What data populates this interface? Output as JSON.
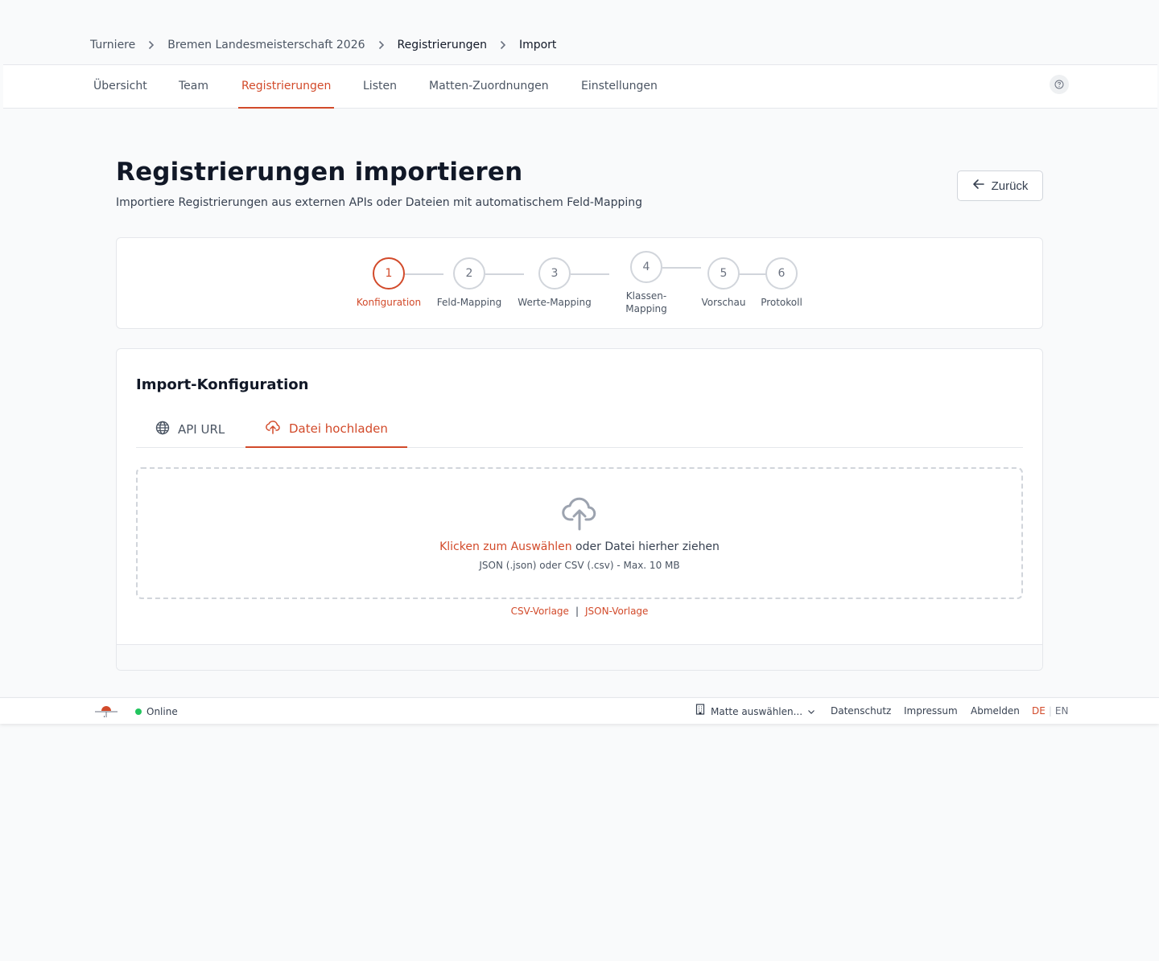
{
  "breadcrumb": {
    "items": [
      "Turniere",
      "Bremen Landesmeisterschaft 2026",
      "Registrierungen",
      "Import"
    ]
  },
  "nav": {
    "tabs": [
      "Übersicht",
      "Team",
      "Registrierungen",
      "Listen",
      "Matten-Zuordnungen",
      "Einstellungen"
    ],
    "active": "Registrierungen",
    "help_icon": "question-circle-icon"
  },
  "header": {
    "title": "Registrierungen importieren",
    "subtitle": "Importiere Registrierungen aus externen APIs oder Dateien mit automatischem Feld-Mapping",
    "back_label": "Zurück"
  },
  "stepper": {
    "current": 1,
    "steps": [
      {
        "number": "1",
        "label": "Konfiguration"
      },
      {
        "number": "2",
        "label": "Feld-Mapping"
      },
      {
        "number": "3",
        "label": "Werte-Mapping"
      },
      {
        "number": "4",
        "label_line1": "Klassen-",
        "label_line2": "Mapping"
      },
      {
        "number": "5",
        "label": "Vorschau"
      },
      {
        "number": "6",
        "label": "Protokoll"
      }
    ]
  },
  "config": {
    "title": "Import-Konfiguration",
    "tabs": [
      {
        "label": "API URL",
        "icon": "globe-icon"
      },
      {
        "label": "Datei hochladen",
        "icon": "upload-cloud-icon"
      }
    ],
    "active_tab": "Datei hochladen",
    "dropzone": {
      "link_text": "Klicken zum Auswählen",
      "rest_text": " oder Datei hierher ziehen",
      "hint": "JSON (.json) oder CSV (.csv) - Max. 10 MB"
    },
    "templates": {
      "csv": "CSV-Vorlage",
      "separator": "|",
      "json": "JSON-Vorlage"
    }
  },
  "footer": {
    "status": "Online",
    "mat_select": "Matte auswählen...",
    "links": [
      "Datenschutz",
      "Impressum",
      "Abmelden"
    ],
    "lang_active": "DE",
    "lang_separator": "|",
    "lang_other": "EN"
  },
  "colors": {
    "accent": "#d24a2a",
    "online": "#22c55e",
    "background": "#f9fafb"
  }
}
